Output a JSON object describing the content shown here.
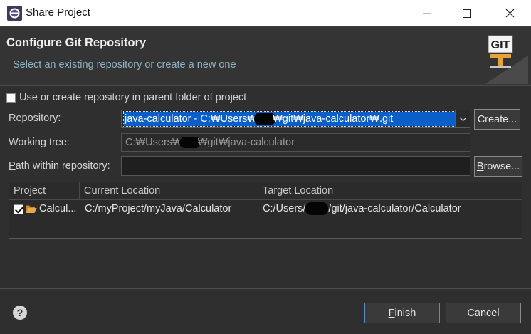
{
  "window": {
    "title": "Share Project",
    "controls": {
      "minimize": "—",
      "maximize": "☐",
      "close": "✕"
    }
  },
  "header": {
    "title": "Configure Git Repository",
    "description": "Select an existing repository or create a new one",
    "logo_text": "GIT"
  },
  "options": {
    "use_parent_label": "Use or create repository in parent folder of project",
    "use_parent_checked": false
  },
  "repository": {
    "label": "Repository:",
    "value_prefix": "java-calculator - C:₩Users₩",
    "value_suffix": "₩git₩java-calculator₩.git",
    "create_button": "Create..."
  },
  "working_tree": {
    "label": "Working tree:",
    "value_prefix": "C:₩Users₩",
    "value_suffix": "₩git₩java-calculator"
  },
  "path_within": {
    "label": "Path within repository:",
    "value": "",
    "browse_button": "Browse..."
  },
  "table": {
    "headers": [
      "Project",
      "Current Location",
      "Target Location"
    ],
    "rows": [
      {
        "checked": true,
        "project": "Calcul...",
        "current": "C:/myProject/myJava/Calculator",
        "target_prefix": "C:/Users/",
        "target_suffix": "/git/java-calculator/Calculator"
      }
    ]
  },
  "footer": {
    "help_icon": "?",
    "finish": "Finish",
    "cancel": "Cancel"
  },
  "colors": {
    "background": "#2f2f2f",
    "selection": "#0a5ec7",
    "description": "#8fb3c4"
  }
}
